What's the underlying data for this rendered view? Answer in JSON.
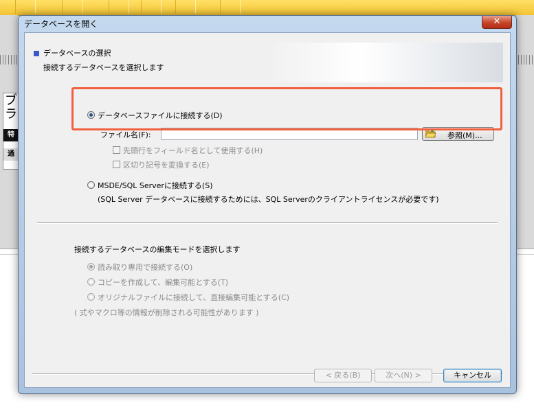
{
  "dialog": {
    "title": "データベースを開く",
    "close_label": "✕"
  },
  "header": {
    "title": "データベースの選択",
    "subtitle": "接続するデータベースを選択します"
  },
  "file_option": {
    "label": "データベースファイルに接続する(D)",
    "selected": true,
    "filename_label": "ファイル名(F):",
    "filename_value": "",
    "browse_label": "参照(M)...",
    "first_row_label": "先頭行をフィールド名として使用する(H)",
    "convert_delim_label": "区切り記号を変換する(E)"
  },
  "sql_option": {
    "label": "MSDE/SQL Serverに接続する(S)",
    "note": "(SQL Server データベースに接続するためには、SQL Serverのクライアントライセンスが必要です)"
  },
  "edit_mode": {
    "title": "接続するデータベースの編集モードを選択します",
    "options": [
      "読み取り専用で接続する(O)",
      "コピーを作成して、編集可能とする(T)",
      "オリジナルファイルに接続して、直接編集可能とする(C)"
    ],
    "note": "( 式やマクロ等の情報が削除される可能性があります )"
  },
  "buttons": {
    "back": "< 戻る(B)",
    "next": "次へ(N) >",
    "cancel": "キャンセル"
  },
  "background_app": {
    "left_panel_chars": [
      "ブ",
      "ラ"
    ],
    "left_tab_1": "特",
    "left_tab_2": "通"
  }
}
